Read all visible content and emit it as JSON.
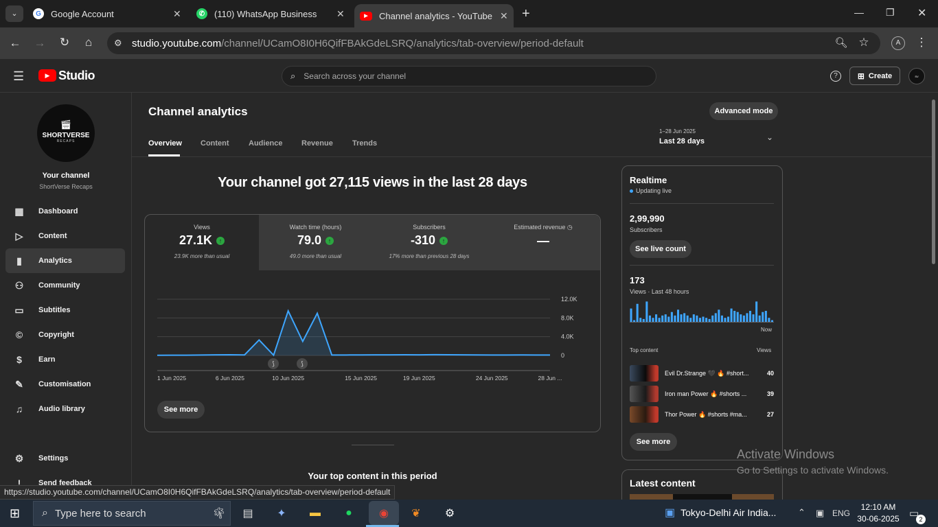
{
  "browser": {
    "tabs": [
      {
        "title": "Google Account",
        "icon": "google-icon"
      },
      {
        "title": "(110) WhatsApp Business",
        "icon": "whatsapp-icon"
      },
      {
        "title": "Channel analytics - YouTube Studio",
        "icon": "youtube-icon"
      }
    ],
    "url_host": "studio.youtube.com",
    "url_path": "/channel/UCamO8I0H6QifFBAkGdeLSRQ/analytics/tab-overview/period-default",
    "status_url": "https://studio.youtube.com/channel/UCamO8I0H6QifFBAkGdeLSRQ/analytics/tab-overview/period-default",
    "profile_letter": "A"
  },
  "header": {
    "logo_text": "Studio",
    "search_placeholder": "Search across your channel",
    "create_label": "Create"
  },
  "channel": {
    "avatar_line1": "SHORTVERSE",
    "avatar_line2": "RECAPS",
    "your_channel": "Your channel",
    "name": "ShortVerse Recaps"
  },
  "sidebar": {
    "items": [
      {
        "label": "Dashboard",
        "icon": "dashboard-icon"
      },
      {
        "label": "Content",
        "icon": "content-icon"
      },
      {
        "label": "Analytics",
        "icon": "analytics-icon",
        "selected": true
      },
      {
        "label": "Community",
        "icon": "community-icon"
      },
      {
        "label": "Subtitles",
        "icon": "subtitles-icon"
      },
      {
        "label": "Copyright",
        "icon": "copyright-icon"
      },
      {
        "label": "Earn",
        "icon": "earn-icon"
      },
      {
        "label": "Customisation",
        "icon": "customisation-icon"
      },
      {
        "label": "Audio library",
        "icon": "audio-library-icon"
      }
    ],
    "settings": "Settings",
    "feedback": "Send feedback"
  },
  "main": {
    "title": "Channel analytics",
    "advanced_mode": "Advanced mode",
    "tabs": [
      "Overview",
      "Content",
      "Audience",
      "Revenue",
      "Trends"
    ],
    "date_range": "1–28 Jun 2025",
    "period": "Last 28 days",
    "headline": "Your channel got 27,115 views in the last 28 days",
    "metrics": [
      {
        "label": "Views",
        "value": "27.1K",
        "sub": "23.9K more than usual"
      },
      {
        "label": "Watch time (hours)",
        "value": "79.0",
        "sub": "49.0 more than usual"
      },
      {
        "label": "Subscribers",
        "value": "-310",
        "sub": "17% more than previous 28 days"
      },
      {
        "label": "Estimated revenue",
        "value": "—",
        "sub": ""
      }
    ],
    "see_more": "See more",
    "top_content_heading": "Your top content in this period"
  },
  "chart_data": {
    "type": "area",
    "x_tick_labels": [
      "1 Jun 2025",
      "6 Jun 2025",
      "10 Jun 2025",
      "15 Jun 2025",
      "19 Jun 2025",
      "24 Jun 2025",
      "28 Jun ..."
    ],
    "y_tick_labels": [
      "12.0K",
      "8.0K",
      "4.0K",
      "0"
    ],
    "ylim": [
      0,
      12000
    ],
    "x": [
      1,
      2,
      3,
      4,
      5,
      6,
      7,
      8,
      9,
      10,
      11,
      12,
      13,
      14,
      15,
      16,
      17,
      18,
      19,
      20,
      21,
      22,
      23,
      24,
      25,
      26,
      27,
      28
    ],
    "values": [
      30,
      60,
      60,
      90,
      120,
      150,
      110,
      3300,
      50,
      9500,
      3000,
      9000,
      100,
      100,
      110,
      130,
      120,
      140,
      130,
      160,
      140,
      120,
      110,
      100,
      100,
      110,
      100,
      100
    ],
    "grid": true,
    "legend": "none"
  },
  "realtime": {
    "title": "Realtime",
    "updating": "Updating live",
    "subscribers_value": "2,99,990",
    "subscribers_label": "Subscribers",
    "see_live_count": "See live count",
    "views_value": "173",
    "views_label": "Views · Last 48 hours",
    "now_label": "Now",
    "bars": [
      0.6,
      0.1,
      0.8,
      0.2,
      0.15,
      0.9,
      0.3,
      0.2,
      0.35,
      0.2,
      0.3,
      0.35,
      0.25,
      0.45,
      0.3,
      0.55,
      0.35,
      0.4,
      0.3,
      0.2,
      0.35,
      0.3,
      0.2,
      0.25,
      0.2,
      0.15,
      0.3,
      0.4,
      0.55,
      0.3,
      0.2,
      0.25,
      0.6,
      0.5,
      0.45,
      0.35,
      0.3,
      0.4,
      0.5,
      0.35,
      0.9,
      0.3,
      0.45,
      0.5,
      0.2,
      0.1
    ],
    "top_content_label": "Top content",
    "views_col_label": "Views",
    "top_content": [
      {
        "title": "Evil Dr.Strange 🖤 🔥 #short...",
        "views": "40"
      },
      {
        "title": "Iron man Power 🔥 #shorts ...",
        "views": "39"
      },
      {
        "title": "Thor Power 🔥 #shorts #ma...",
        "views": "27"
      }
    ],
    "see_more": "See more"
  },
  "latest": {
    "title": "Latest content"
  },
  "watermark": {
    "line1": "Activate Windows",
    "line2": "Go to Settings to activate Windows."
  },
  "taskbar": {
    "search_placeholder": "Type here to search",
    "news": "Tokyo-Delhi Air India...",
    "lang": "ENG",
    "time": "12:10 AM",
    "date": "30-06-2025",
    "notif_count": "2"
  },
  "colors": {
    "accent": "#3ea6ff",
    "youtube_red": "#ff0000",
    "up_green": "#2ba640"
  }
}
